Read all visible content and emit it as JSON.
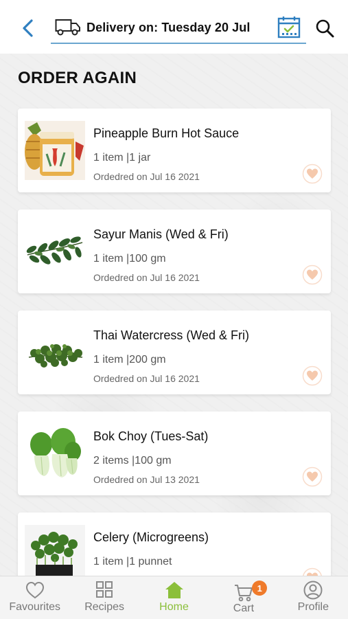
{
  "header": {
    "delivery_text": "Delivery on: Tuesday 20 Jul"
  },
  "page": {
    "title": "ORDER AGAIN"
  },
  "orders": [
    {
      "name": "Pineapple Burn Hot Sauce",
      "quantity": "1 item |1 jar",
      "ordered": "Ordedred on Jul 16 2021",
      "thumb": "hot-sauce-jar"
    },
    {
      "name": "Sayur Manis (Wed & Fri)",
      "quantity": "1 item |100 gm",
      "ordered": "Ordedred on Jul 16 2021",
      "thumb": "sayur-manis-leaves"
    },
    {
      "name": "Thai Watercress (Wed & Fri)",
      "quantity": "1 item |200 gm",
      "ordered": "Ordedred on Jul 16 2021",
      "thumb": "watercress"
    },
    {
      "name": "Bok Choy (Tues-Sat)",
      "quantity": "2 items |100 gm",
      "ordered": "Ordedred on Jul 13 2021",
      "thumb": "bok-choy"
    },
    {
      "name": "Celery (Microgreens)",
      "quantity": "1 item |1 punnet",
      "ordered": "",
      "thumb": "celery-microgreens"
    }
  ],
  "nav": {
    "favourites": "Favourites",
    "recipes": "Recipes",
    "home": "Home",
    "cart": "Cart",
    "cart_count": "1",
    "profile": "Profile"
  },
  "colors": {
    "accent_blue": "#2f7fc0",
    "active_green": "#8bbf3a",
    "badge_orange": "#ef7a2a",
    "heart_peach": "#f5c9ad"
  }
}
